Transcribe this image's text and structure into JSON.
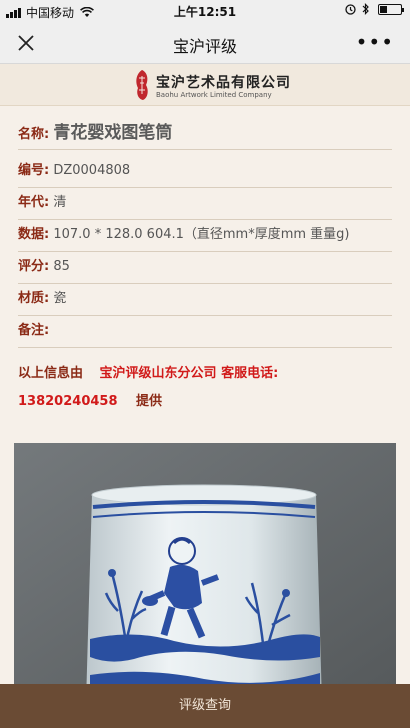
{
  "status": {
    "carrier": "中国移动",
    "time": "上午12:51"
  },
  "nav": {
    "title": "宝沪评级",
    "more": "•••"
  },
  "company": {
    "name_cn": "宝沪艺术品有限公司",
    "name_en": "Baohu Artwork Limited  Company"
  },
  "details": [
    {
      "label": "名称:",
      "value": "青花婴戏图笔筒"
    },
    {
      "label": "编号:",
      "value": "DZ0004808"
    },
    {
      "label": "年代:",
      "value": "清"
    },
    {
      "label": "数据:",
      "value": "107.0 * 128.0 604.1（直径mm*厚度mm 重量g)"
    },
    {
      "label": "评分:",
      "value": "85"
    },
    {
      "label": "材质:",
      "value": "瓷"
    },
    {
      "label": "备注:",
      "value": ""
    }
  ],
  "notice": {
    "prefix": "以上信息由",
    "provider": "宝沪评级山东分公司 客服电话:",
    "phone": "13820240458",
    "suffix": "提供"
  },
  "bottom": {
    "button": "评级查询"
  },
  "colors": {
    "label": "#8b2a16",
    "highlight": "#d11a1a",
    "bottom_bar": "#6a4b34"
  },
  "icons": [
    "signal-icon",
    "wifi-icon",
    "close-icon",
    "more-icon",
    "lock-icon",
    "bluetooth-icon",
    "battery-icon",
    "seal-logo-icon"
  ]
}
